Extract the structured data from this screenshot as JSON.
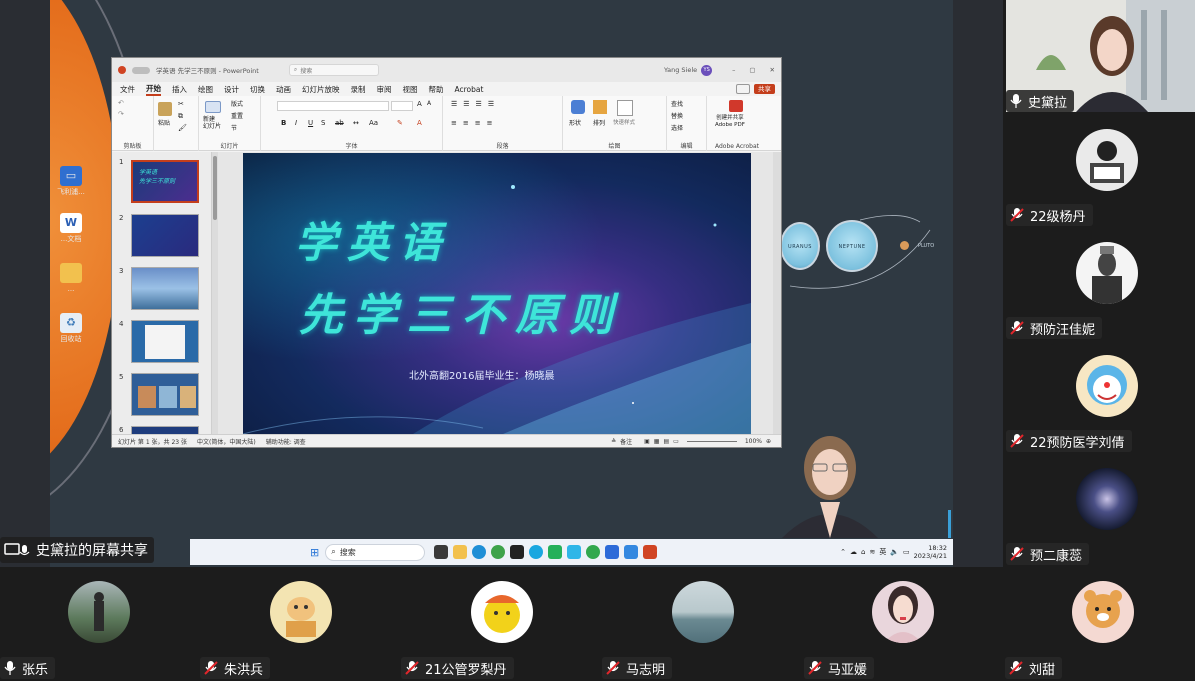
{
  "share": {
    "label": "史黛拉的屏幕共享"
  },
  "desktop": {
    "icons": [
      {
        "name": "monitor-icon",
        "label": "飞利浦..."
      },
      {
        "name": "word-icon",
        "label": "...文档"
      },
      {
        "name": "folder-icon",
        "label": "..."
      },
      {
        "name": "recycle-icon",
        "label": "回收站"
      }
    ],
    "planets": [
      "URANUS",
      "NEPTUNE",
      "PLUTO"
    ]
  },
  "ppt": {
    "title": "学英语 先学三不原则 - PowerPoint",
    "user": "Yang Siele",
    "user_initials": "YS",
    "search_placeholder": "搜索",
    "menu": [
      "文件",
      "开始",
      "插入",
      "绘图",
      "设计",
      "切换",
      "动画",
      "幻灯片放映",
      "录制",
      "审阅",
      "视图",
      "帮助",
      "Acrobat"
    ],
    "share_button": "共享",
    "groups": [
      "剪贴板",
      "幻灯片",
      "字体",
      "段落",
      "绘图",
      "编辑",
      "Adobe Acrobat"
    ],
    "ribbon_labels": {
      "paste": "粘贴",
      "new_slide": "新建\n幻灯片",
      "layout": "版式",
      "reset": "重置",
      "section": "节",
      "shapes": "形状",
      "arrange": "排列",
      "quick_styles": "快速样式",
      "find": "查找",
      "replace": "替换",
      "select": "选择",
      "adobe": "创建并共享\nAdobe PDF"
    },
    "slides": [
      {
        "num": "1",
        "kind": "title"
      },
      {
        "num": "2",
        "kind": "dark"
      },
      {
        "num": "3",
        "kind": "sea"
      },
      {
        "num": "4",
        "kind": "doc"
      },
      {
        "num": "5",
        "kind": "photos"
      },
      {
        "num": "6",
        "kind": "dark"
      }
    ],
    "slide": {
      "title1": "学英语",
      "title2": "先学三不原则",
      "subtitle": "北外高翻2016届毕业生：杨晓晨"
    },
    "status": {
      "slide_count": "幻灯片 第 1 张，共 23 张",
      "language": "中文(简体，中国大陆)",
      "accessibility": "辅助功能: 调查",
      "notes": "备注",
      "zoom": "100%"
    }
  },
  "taskbar": {
    "search_placeholder": "搜索",
    "time": "18:32",
    "date": "2023/4/21",
    "ime": "英"
  },
  "right_participants": [
    {
      "name": "史黛拉",
      "muted": false,
      "kind": "video"
    },
    {
      "name": "22级杨丹",
      "muted": true,
      "kind": "sketch"
    },
    {
      "name": "预防汪佳妮",
      "muted": true,
      "kind": "bw"
    },
    {
      "name": "22预防医学刘倩",
      "muted": true,
      "kind": "cartoon"
    },
    {
      "name": "预二康蕊",
      "muted": true,
      "kind": "galaxy"
    }
  ],
  "bottom_participants": [
    {
      "name": "张乐",
      "muted": false,
      "kind": "landscape"
    },
    {
      "name": "朱洪兵",
      "muted": true,
      "kind": "cartoon2"
    },
    {
      "name": "21公管罗梨丹",
      "muted": true,
      "kind": "food"
    },
    {
      "name": "马志明",
      "muted": true,
      "kind": "lake"
    },
    {
      "name": "马亚媛",
      "muted": true,
      "kind": "portrait"
    },
    {
      "name": "刘甜",
      "muted": true,
      "kind": "tiger"
    }
  ],
  "colors": {
    "slide_title": "#3ee5d9",
    "ppt_accent": "#c43e1c",
    "desk_orange": "#e46d1c",
    "mute_red": "#e0262b"
  }
}
